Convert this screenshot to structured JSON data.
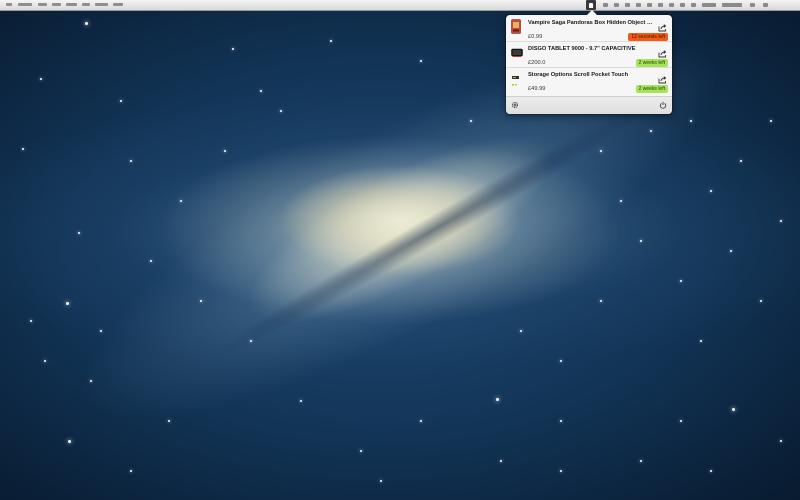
{
  "menubar": {
    "app_icon": "price-tag-icon"
  },
  "popover": {
    "items": [
      {
        "title": "Vampire Saga Pandoras Box Hidden Object Game",
        "price": "£0.99",
        "time_left": "12 seconds left",
        "status": "urgent",
        "thumb_icon": "game-box-icon"
      },
      {
        "title": "DISGO TABLET 9000 - 9.7\" CAPACITIVE",
        "price": "£200.0",
        "time_left": "2 weeks left",
        "status": "ok",
        "thumb_icon": "tablet-icon"
      },
      {
        "title": "Storage Options Scroll Pocket Touch",
        "price": "£49.99",
        "time_left": "2 weeks left",
        "status": "ok",
        "thumb_icon": "media-player-icon"
      }
    ],
    "footer": {
      "settings_icon": "gear-icon",
      "quit_icon": "power-icon"
    }
  },
  "colors": {
    "urgent_badge": "#f25a17",
    "ok_badge": "#a6e35a",
    "popover_bg": "#f6f6f6"
  }
}
